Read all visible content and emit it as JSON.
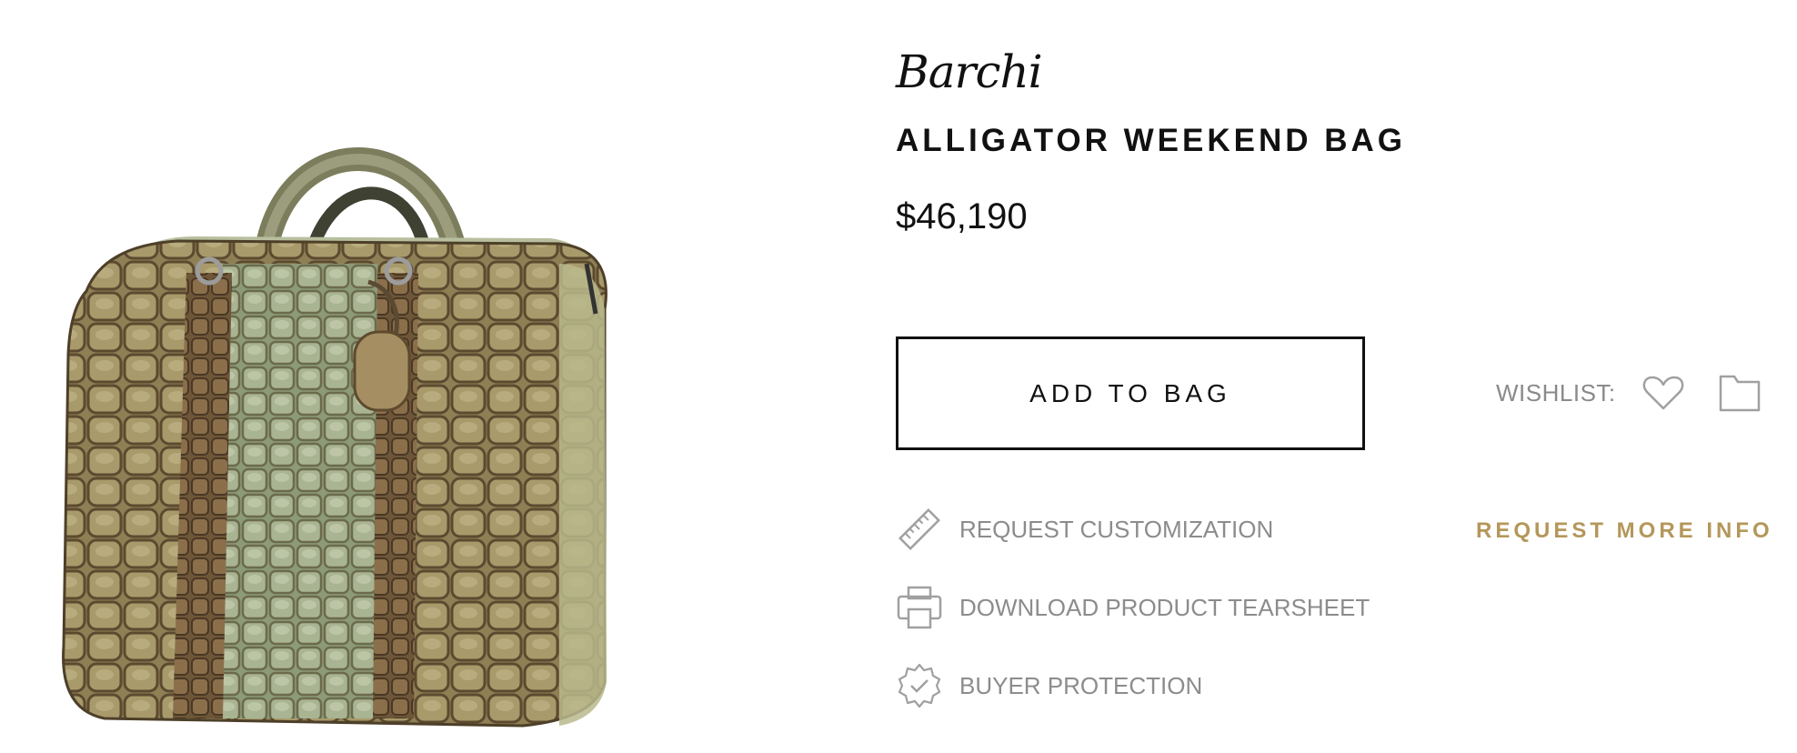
{
  "product": {
    "brand": "Barchi",
    "title": "ALLIGATOR WEEKEND BAG",
    "price": "$46,190"
  },
  "actions": {
    "add_to_bag": "ADD TO BAG",
    "wishlist_label": "WISHLIST:",
    "request_more_info": "REQUEST MORE INFO",
    "links": [
      {
        "label": "REQUEST CUSTOMIZATION",
        "icon": "ruler-icon"
      },
      {
        "label": "DOWNLOAD PRODUCT TEARSHEET",
        "icon": "printer-icon"
      },
      {
        "label": "BUYER PROTECTION",
        "icon": "badge-check-icon"
      }
    ]
  },
  "colors": {
    "accent_gold": "#b4975a",
    "muted_text": "#8c8c8c",
    "text": "#111111"
  },
  "icons": [
    "heart-icon",
    "folder-icon",
    "ruler-icon",
    "printer-icon",
    "badge-check-icon"
  ]
}
